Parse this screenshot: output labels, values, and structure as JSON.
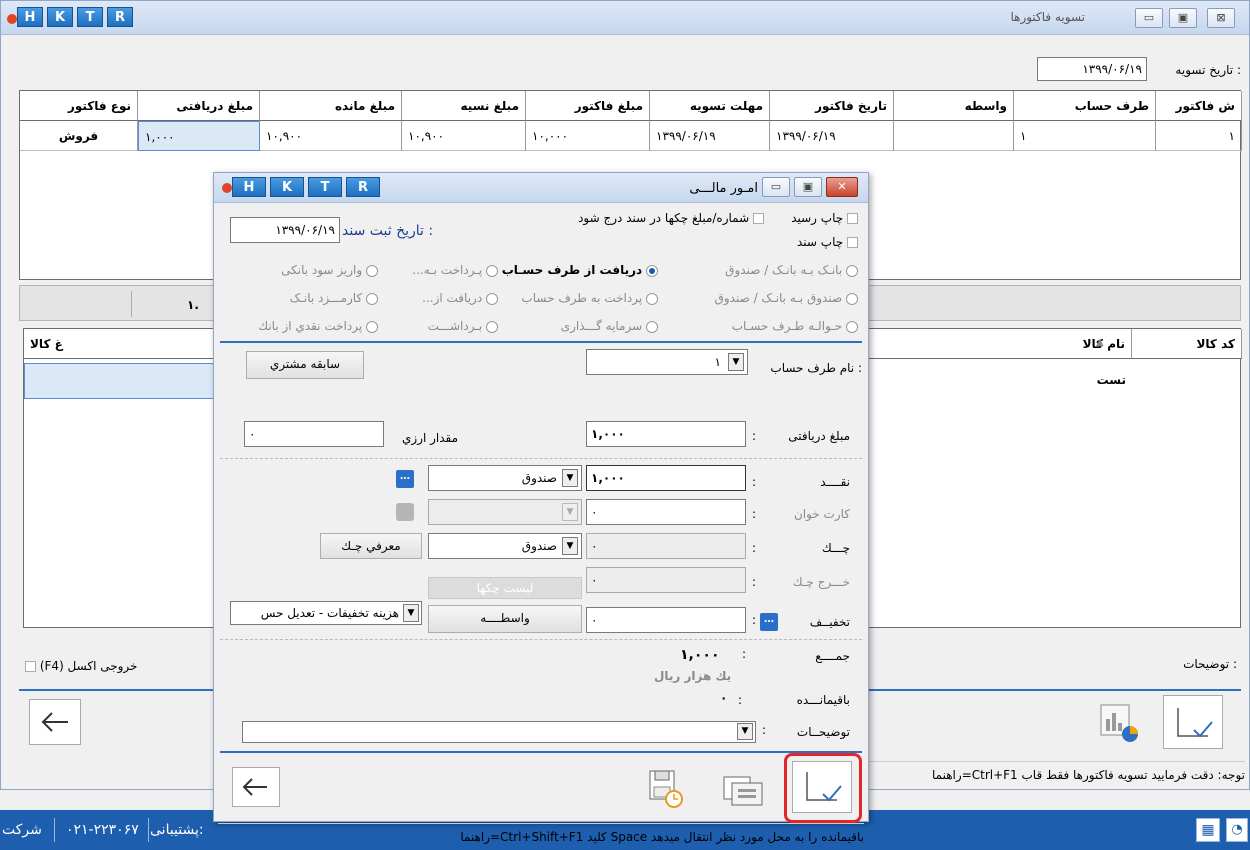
{
  "main": {
    "title": "تسویه فاکتورها",
    "hktr": [
      "H",
      "K",
      "T",
      "R"
    ],
    "settle_date_label": "تاریخ تسویه :",
    "settle_date": "۱۳۹۹/۰۶/۱۹",
    "columns": [
      "ش فاکتور",
      "طرف حساب",
      "واسطه",
      "تاریخ فاکتور",
      "مهلت تسویه",
      "مبلغ فاکتور",
      "مبلغ نسیه",
      "مبلغ مانده",
      "مبلغ دریافتی",
      "نوع فاکتور"
    ],
    "row": [
      "۱",
      "۱",
      "",
      "۱۳۹۹/۰۶/۱۹",
      "۱۳۹۹/۰۶/۱۹",
      "۱۰,۰۰۰",
      "۱۰,۹۰۰",
      "۱۰,۹۰۰",
      "۱,۰۰۰",
      "فروش"
    ],
    "sum_fragment": "۱.",
    "goods_columns": [
      "کد کالا",
      "نام کالا",
      "غ کالا"
    ],
    "goods_row_name": "تست",
    "notes_label": "توضیحات :",
    "excel_label": "خروجی اکسل (F4)",
    "hint": "راهنما=Ctrl+F1   توجه: دقت فرمایید تسویه فاکتورها فقط قاب"
  },
  "dialog": {
    "title": "امـور مالـــی",
    "hktr": [
      "H",
      "K",
      "T",
      "R"
    ],
    "print_receipt": "چاپ رسید",
    "print_doc": "چاپ سند",
    "cheque_in_doc": "شماره/مبلغ چکها در سند درج شود",
    "doc_date_label": "تاریخ ثبت سند :",
    "doc_date": "۱۳۹۹/۰۶/۱۹",
    "radios": [
      [
        "بانـک بـه بانـک / صندوق",
        "دریافت از طرف حسـاب",
        "پـرداخت بـه...",
        "واریز سود بانکی"
      ],
      [
        "صندوق بـه بانـک / صندوق",
        "پرداخت به طرف حساب",
        "دریافت از...",
        "کارمـــزد بانـک"
      ],
      [
        "حـوالـه طـرف حسـاب",
        "سرمایه گـــذاری",
        "بـرداشـــت",
        "پرداخت نقدي از بانك"
      ]
    ],
    "party_label": "نام طرف حساب :",
    "party_value": "۱",
    "history_btn": "سابقه مشتري",
    "amount_label": "مبلغ دریافتی",
    "amount_value": "۱,۰۰۰",
    "currency_label": "مقدار ارزي",
    "currency_value": "۰",
    "cash_label": "نقــــد",
    "cash_value": "۱,۰۰۰",
    "cash_box": "صندوق",
    "card_label": "کارت خوان",
    "card_value": "۰",
    "cheque_label": "چـــك",
    "cheque_value": "۰",
    "cheque_box": "صندوق",
    "cheque_intro_btn": "معرفي چـك",
    "cheque_out_label": "خـــرج چـك",
    "cheque_list_btn": "لیست چکها",
    "discount_label": "تخفیــف",
    "discount_value": "۰",
    "discount_btn": "واسطــــه",
    "discount_box": "هزینه تخفیفات - تعدیل حس",
    "total_label": "جمــــع",
    "total_value": "۱,۰۰۰",
    "total_words": "يك هزار ريال",
    "remaining_label": "باقیمانـــده",
    "remaining_value": "۰",
    "notes_label": "توضیحــات",
    "hint": "راهنما=Ctrl+Shift+F1   کلید Space باقیمانده را به محل مورد نظر انتقال میدهد"
  },
  "taskbar": {
    "phone": "۰۲۱-۲۲۳۰۶۷",
    "support": "پشتیبانی:",
    "company": "شرکت"
  },
  "colors": {
    "accent": "#2f6fc2",
    "highlight": "#e3262b",
    "taskbar": "#1d5fae"
  }
}
